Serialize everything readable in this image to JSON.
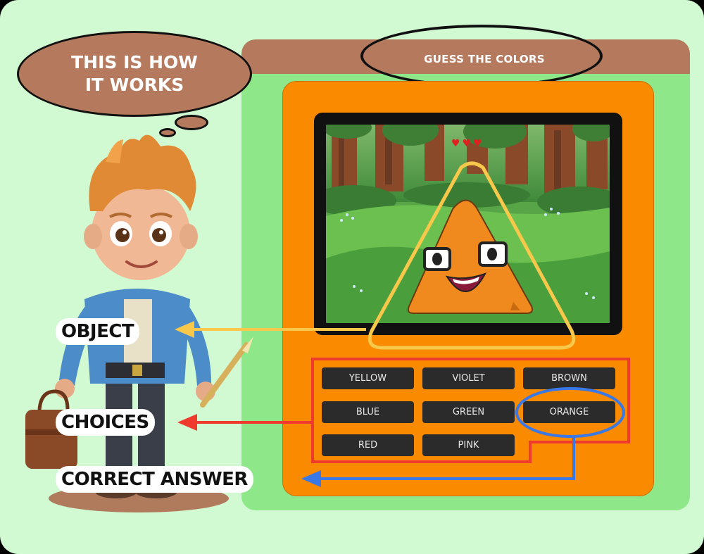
{
  "game": {
    "title": "GUESS THE COLORS",
    "lives": 3,
    "choices": [
      "YELLOW",
      "VIOLET",
      "BROWN",
      "BLUE",
      "GREEN",
      "ORANGE",
      "RED",
      "PINK"
    ],
    "correct_answer": "ORANGE"
  },
  "tutorial": {
    "thought_line1": "THIS IS HOW",
    "thought_line2": "IT WORKS",
    "label_object": "OBJECT",
    "label_choices": "CHOICES",
    "label_correct": "CORRECT ANSWER"
  },
  "colors": {
    "background": "#d2fad2",
    "panel": "#8ee88a",
    "header": "#b57a5e",
    "card": "#fa8a00",
    "button": "#2b2b2b",
    "object_arrow": "#f7c84a",
    "choices_arrow": "#f03a2e",
    "answer_arrow": "#3a78e6"
  },
  "icons": [
    "heart-icon",
    "arrow-left-icon",
    "triangle-character-icon",
    "boy-character-icon"
  ]
}
